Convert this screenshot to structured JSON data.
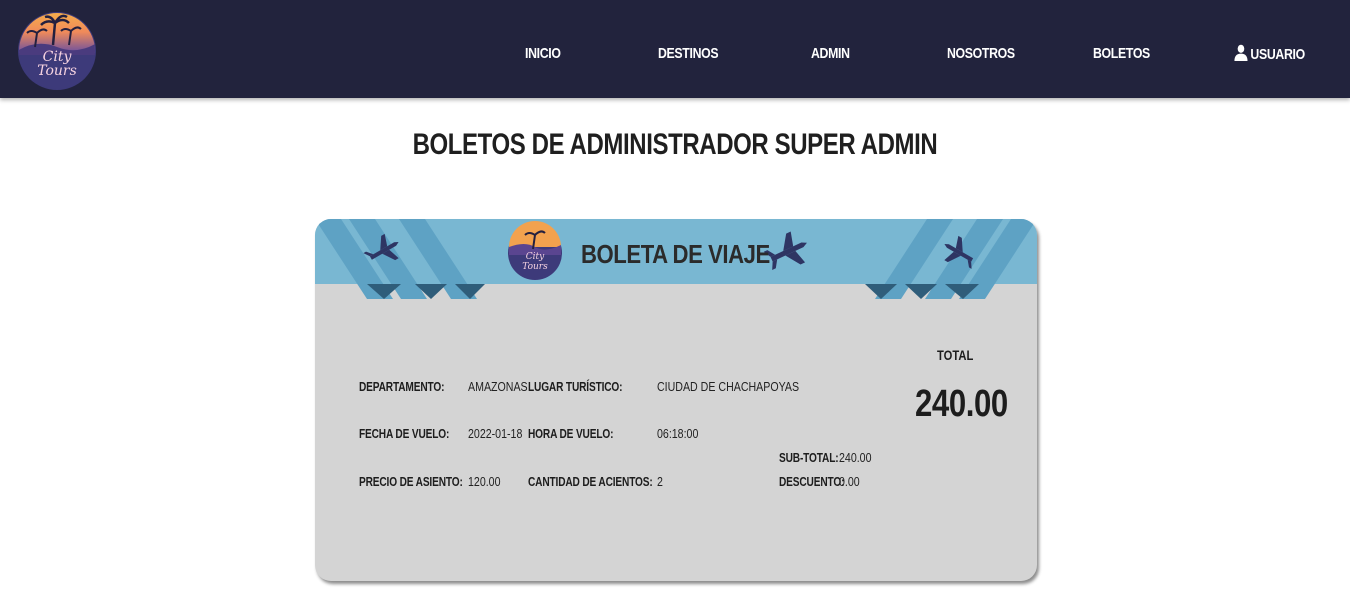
{
  "navbar": {
    "logo_text": "City Tours",
    "items": [
      {
        "label": "INICIO"
      },
      {
        "label": "DESTINOS"
      },
      {
        "label": "ADMIN"
      },
      {
        "label": "NOSOTROS"
      },
      {
        "label": "BOLETOS"
      },
      {
        "label": "USUARIO",
        "icon": "user-icon"
      }
    ]
  },
  "page": {
    "title": "BOLETOS DE ADMINISTRADOR SUPER ADMIN"
  },
  "ticket": {
    "title": "BOLETA DE VIAJE",
    "logo_text": "City Tours",
    "icons": [
      "airplane-icon"
    ],
    "colors": {
      "header": "#78b6d1",
      "stripe": "#5a9fc2",
      "body": "#d4d4d4",
      "navbar": "#22233d"
    },
    "fields": {
      "departamento_label": "DEPARTAMENTO:",
      "departamento_value": "AMAZONAS",
      "lugar_label": "LUGAR TURÍSTICO:",
      "lugar_value": "CIUDAD DE CHACHAPOYAS",
      "fecha_label": "FECHA DE VUELO:",
      "fecha_value": "2022-01-18",
      "hora_label": "HORA DE VUELO:",
      "hora_value": "06:18:00",
      "precio_label": "PRECIO DE ASIENTO:",
      "precio_value": "120.00",
      "cantidad_label": "CANTIDAD DE ACIENTOS:",
      "cantidad_value": "2"
    },
    "summary": {
      "total_label": "TOTAL",
      "total_value": "240.00",
      "subtotal_label": "SUB-TOTAL:",
      "subtotal_value": "240.00",
      "descuento_label": "DESCUENTO:",
      "descuento_value": "0.00"
    }
  }
}
